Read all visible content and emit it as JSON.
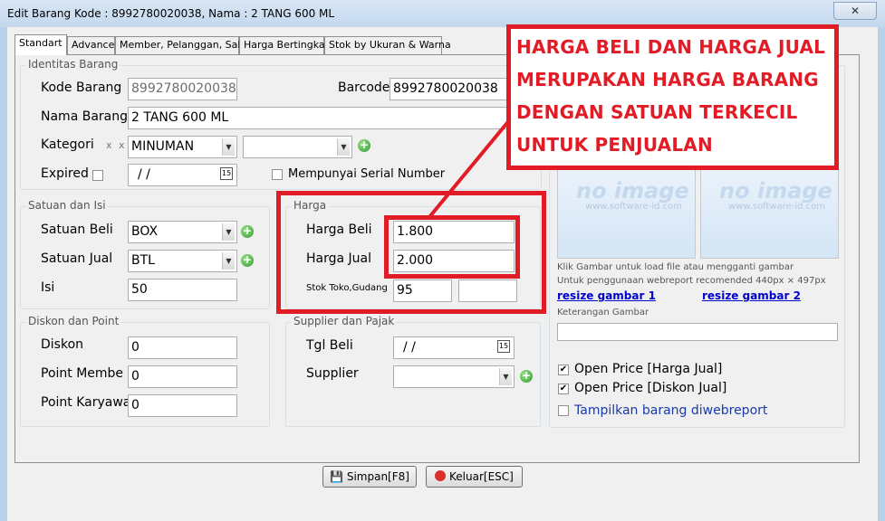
{
  "window": {
    "title": "Edit Barang  Kode : 8992780020038, Nama : 2 TANG 600 ML",
    "close_label": "✕"
  },
  "tabs": [
    "Standart",
    "Advance",
    "Member, Pelanggan, Sales",
    "Harga Bertingkat",
    "Stok by Ukuran & Warna"
  ],
  "identitas": {
    "title": "Identitas Barang",
    "kode_label": "Kode Barang",
    "kode_value": "8992780020038",
    "barcode_label": "Barcode",
    "barcode_value": "8992780020038",
    "nama_label": "Nama Barang",
    "nama_value": "2 TANG 600 ML",
    "kategori_label": "Kategori",
    "kategori_x1": "x",
    "kategori_x2": "x",
    "kategori_value": "MINUMAN",
    "kategori2_value": "",
    "expired_label": "Expired",
    "expired_value": "/ /",
    "serial_label": "Mempunyai Serial Number"
  },
  "satuan": {
    "title": "Satuan dan Isi",
    "beli_label": "Satuan Beli",
    "beli_value": "BOX",
    "jual_label": "Satuan Jual",
    "jual_value": "BTL",
    "isi_label": "Isi",
    "isi_value": "50"
  },
  "harga": {
    "title": "Harga",
    "beli_label": "Harga Beli",
    "beli_value": "1.800",
    "jual_label": "Harga Jual",
    "jual_value": "2.000",
    "stok_label": "Stok Toko,Gudang",
    "stok_toko": "95",
    "stok_gudang": ""
  },
  "diskon": {
    "title": "Diskon dan Point",
    "diskon_label": "Diskon",
    "diskon_value": "0",
    "point_member_label": "Point Membe",
    "point_member_value": "0",
    "point_karyawan_label": "Point Karyawa",
    "point_karyawan_value": "0"
  },
  "supplier": {
    "title": "Supplier dan Pajak",
    "tgl_label": "Tgl Beli",
    "tgl_value": "/ /",
    "supplier_label": "Supplier",
    "supplier_value": ""
  },
  "gambar": {
    "info_text": "Klik Gambar untuk load file atau mengganti gambar",
    "recommend_text": "Untuk penggunaan webreport recomended 440px × 497px",
    "resize1": "resize gambar 1",
    "resize2": "resize gambar 2",
    "keterangan_label": "Keterangan Gambar",
    "keterangan_value": "",
    "open_price_jual": "Open Price [Harga Jual]",
    "open_price_diskon": "Open Price [Diskon Jual]",
    "tampilkan_web": "Tampilkan barang diwebreport",
    "watermark": "no image",
    "watermark_url": "www.software-id.com"
  },
  "buttons": {
    "simpan": "Simpan[F8]",
    "keluar": "Keluar[ESC]"
  },
  "annotation": {
    "lines": [
      "HARGA BELI DAN HARGA JUAL",
      "MERUPAKAN HARGA BARANG",
      "DENGAN SATUAN TERKECIL",
      "UNTUK PENJUALAN"
    ]
  },
  "colors": {
    "annotation_red": "#e21c26",
    "link_blue": "#0000cc",
    "window_frame": "#b9d1ea"
  }
}
